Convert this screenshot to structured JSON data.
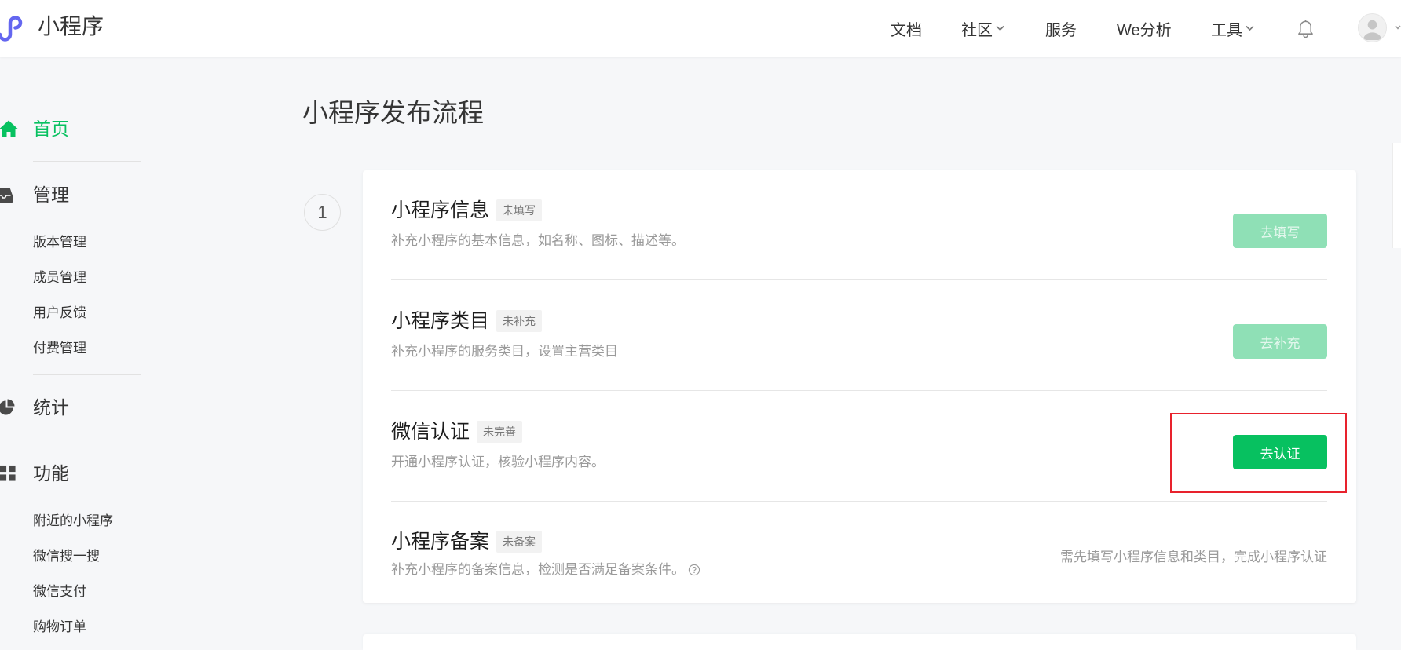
{
  "header": {
    "logo_icon": "mini-program-logo-icon",
    "logo_text": "小程序",
    "nav": [
      {
        "label": "文档",
        "has_dropdown": false
      },
      {
        "label": "社区",
        "has_dropdown": true
      },
      {
        "label": "服务",
        "has_dropdown": false
      },
      {
        "label": "We分析",
        "has_dropdown": false
      },
      {
        "label": "工具",
        "has_dropdown": true
      }
    ],
    "notification_icon": "bell-icon",
    "account_icon": "avatar-icon"
  },
  "sidebar": {
    "home": {
      "label": "首页",
      "icon": "home-icon",
      "active": true
    },
    "manage": {
      "label": "管理",
      "icon": "inbox-icon",
      "items": [
        "版本管理",
        "成员管理",
        "用户反馈",
        "付费管理"
      ]
    },
    "stats": {
      "label": "统计",
      "icon": "pie-chart-icon"
    },
    "features": {
      "label": "功能",
      "icon": "grid-icon",
      "items": [
        "附近的小程序",
        "微信搜一搜",
        "微信支付",
        "购物订单"
      ]
    }
  },
  "main": {
    "title": "小程序发布流程",
    "step": {
      "number": "1",
      "tasks": [
        {
          "title": "小程序信息",
          "status": "未填写",
          "description": "补充小程序的基本信息，如名称、图标、描述等。",
          "action": "去填写",
          "action_enabled": false
        },
        {
          "title": "小程序类目",
          "status": "未补充",
          "description": "补充小程序的服务类目，设置主营类目",
          "action": "去补充",
          "action_enabled": false
        },
        {
          "title": "微信认证",
          "status": "未完善",
          "description": "开通小程序认证，核验小程序内容。",
          "action": "去认证",
          "action_enabled": true
        },
        {
          "title": "小程序备案",
          "status": "未备案",
          "description": "补充小程序的备案信息，检测是否满足备案条件。",
          "help_icon": "question-circle-icon",
          "note": "需先填写小程序信息和类目，完成小程序认证"
        }
      ]
    }
  },
  "colors": {
    "accent": "#07c160",
    "accent_disabled": "#8fe0b6",
    "logo": "#6467f0",
    "highlight": "#e8222d",
    "text": "#353535",
    "muted": "#9a9a9a"
  }
}
